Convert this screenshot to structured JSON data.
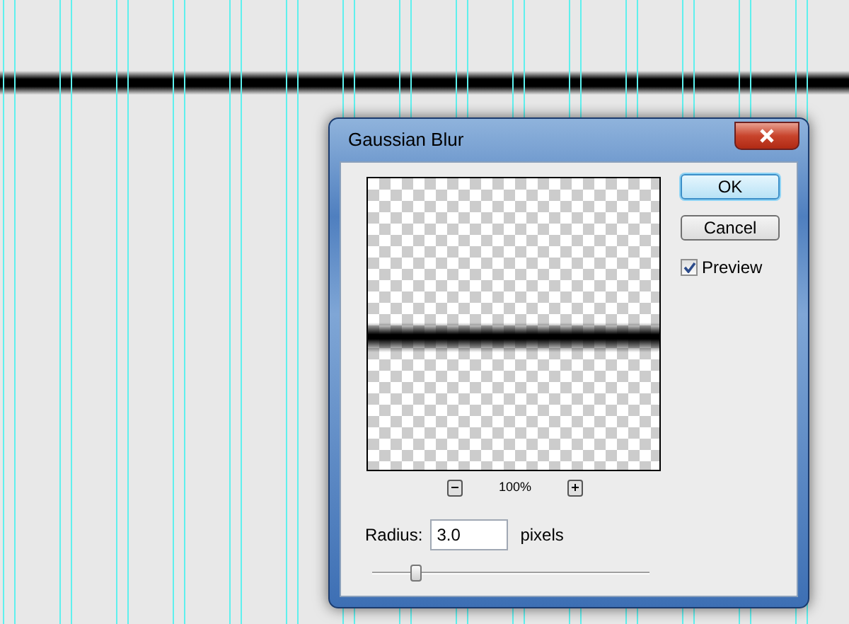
{
  "dialog": {
    "title": "Gaussian Blur",
    "buttons": [
      {
        "label": "OK",
        "default": true
      },
      {
        "label": "Cancel",
        "default": false
      }
    ],
    "preview": {
      "label": "Preview",
      "checked": true
    },
    "zoom": {
      "value": "100%"
    },
    "radius": {
      "label": "Radius:",
      "value": "3.0",
      "unit": "pixels",
      "level": 0.16
    }
  }
}
